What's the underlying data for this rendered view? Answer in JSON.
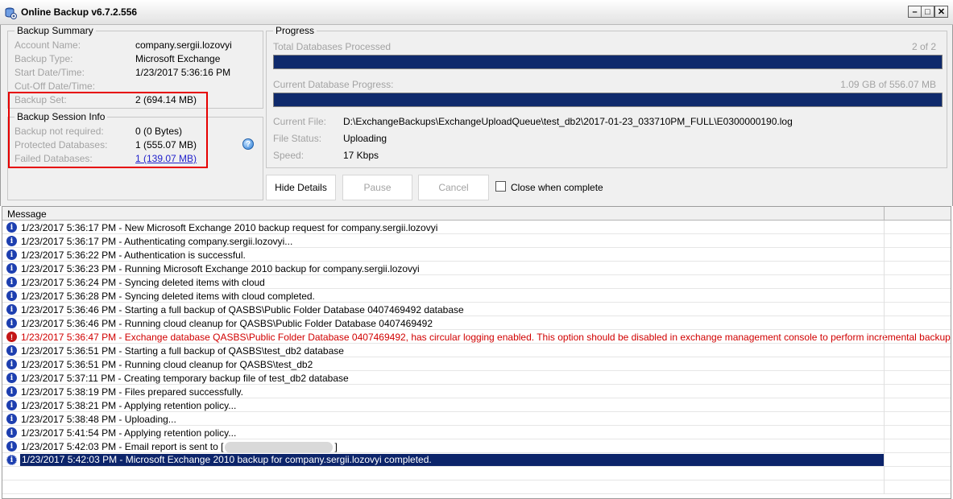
{
  "window": {
    "title": "Online Backup v6.7.2.556"
  },
  "backup_summary": {
    "legend": "Backup Summary",
    "account_name_label": "Account Name:",
    "account_name_value": "company.sergii.lozovyi",
    "backup_type_label": "Backup Type:",
    "backup_type_value": "Microsoft Exchange",
    "start_label": "Start Date/Time:",
    "start_value": "1/23/2017 5:36:16 PM",
    "cutoff_label": "Cut-Off Date/Time:",
    "cutoff_value": "",
    "backup_set_label": "Backup Set:",
    "backup_set_value": "2 (694.14 MB)"
  },
  "session_info": {
    "legend": "Backup Session Info",
    "not_required_label": "Backup not required:",
    "not_required_value": "0 (0 Bytes)",
    "protected_label": "Protected Databases:",
    "protected_value": "1 (555.07 MB)",
    "failed_label": "Failed Databases:",
    "failed_value": "1 (139.07 MB)"
  },
  "progress": {
    "legend": "Progress",
    "total_label": "Total Databases Processed",
    "total_count": "2 of 2",
    "total_fraction": 1.0,
    "current_label": "Current Database Progress:",
    "current_size": "1.09 GB of 556.07 MB",
    "current_fraction": 1.0,
    "current_file_label": "Current File:",
    "current_file_value": "D:\\ExchangeBackups\\ExchangeUploadQueue\\test_db2\\2017-01-23_033710PM_FULL\\E0300000190.log",
    "file_status_label": "File Status:",
    "file_status_value": "Uploading",
    "speed_label": "Speed:",
    "speed_value": "17 Kbps"
  },
  "buttons": {
    "hide_details": "Hide Details",
    "pause": "Pause",
    "cancel": "Cancel",
    "close_when_complete": "Close when complete"
  },
  "log": {
    "column_header": "Message",
    "rows": [
      {
        "type": "info",
        "text": "1/23/2017 5:36:17 PM - New Microsoft Exchange 2010 backup request for company.sergii.lozovyi"
      },
      {
        "type": "info",
        "text": "1/23/2017 5:36:17 PM - Authenticating company.sergii.lozovyi..."
      },
      {
        "type": "info",
        "text": "1/23/2017 5:36:22 PM - Authentication is successful."
      },
      {
        "type": "info",
        "text": "1/23/2017 5:36:23 PM - Running Microsoft Exchange 2010 backup for company.sergii.lozovyi"
      },
      {
        "type": "info",
        "text": "1/23/2017 5:36:24 PM - Syncing deleted items with cloud"
      },
      {
        "type": "info",
        "text": "1/23/2017 5:36:28 PM - Syncing deleted items with cloud completed."
      },
      {
        "type": "info",
        "text": "1/23/2017 5:36:46 PM - Starting a full backup of QASBS\\Public Folder Database 0407469492 database"
      },
      {
        "type": "info",
        "text": "1/23/2017 5:36:46 PM - Running cloud cleanup for QASBS\\Public Folder Database 0407469492"
      },
      {
        "type": "error",
        "text": "1/23/2017 5:36:47 PM - Exchange database QASBS\\Public Folder Database 0407469492, has circular logging enabled. This option should be disabled in exchange management console to perform incremental backups."
      },
      {
        "type": "info",
        "text": "1/23/2017 5:36:51 PM - Starting a full backup of QASBS\\test_db2 database"
      },
      {
        "type": "info",
        "text": "1/23/2017 5:36:51 PM - Running cloud cleanup for QASBS\\test_db2"
      },
      {
        "type": "info",
        "text": "1/23/2017 5:37:11 PM - Creating temporary backup file of test_db2 database"
      },
      {
        "type": "info",
        "text": "1/23/2017 5:38:19 PM - Files prepared successfully."
      },
      {
        "type": "info",
        "text": "1/23/2017 5:38:21 PM - Applying retention policy..."
      },
      {
        "type": "info",
        "text": "1/23/2017 5:38:48 PM - Uploading..."
      },
      {
        "type": "info",
        "text": "1/23/2017 5:41:54 PM - Applying retention policy..."
      },
      {
        "type": "info",
        "text": "1/23/2017 5:42:03 PM - Email report is sent to [",
        "suffix": "]"
      },
      {
        "type": "info",
        "selected": true,
        "text": "1/23/2017 5:42:03 PM - Microsoft Exchange 2010 backup for company.sergii.lozovyi completed."
      }
    ]
  },
  "colors": {
    "accent": "#0f2a6c",
    "error": "#d10000",
    "highlight_box": "#e60000",
    "link": "#2222cc"
  }
}
